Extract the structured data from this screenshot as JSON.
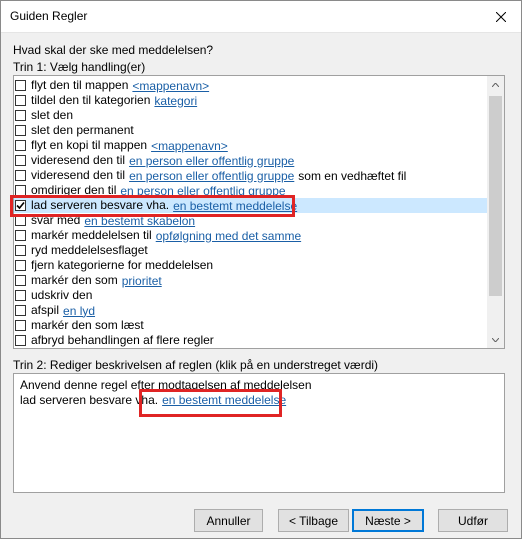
{
  "window": {
    "title": "Guiden Regler"
  },
  "prompt": "Hvad skal der ske med meddelelsen?",
  "step1_label": "Trin 1: Vælg handling(er)",
  "actions": [
    {
      "label": "flyt den til mappen",
      "link": "<mappenavn>",
      "suffix": "",
      "checked": false
    },
    {
      "label": "tildel den til kategorien",
      "link": "kategori",
      "suffix": "",
      "checked": false
    },
    {
      "label": "slet den",
      "link": "",
      "suffix": "",
      "checked": false
    },
    {
      "label": "slet den permanent",
      "link": "",
      "suffix": "",
      "checked": false
    },
    {
      "label": "flyt en kopi til mappen",
      "link": "<mappenavn>",
      "suffix": "",
      "checked": false
    },
    {
      "label": "videresend den til",
      "link": "en person eller offentlig gruppe",
      "suffix": "",
      "checked": false
    },
    {
      "label": "videresend den til",
      "link": "en person eller offentlig gruppe",
      "suffix": "som en vedhæftet fil",
      "checked": false
    },
    {
      "label": "omdiriger den til",
      "link": "en person eller offentlig gruppe",
      "suffix": "",
      "checked": false
    },
    {
      "label": "lad serveren besvare vha.",
      "link": "en bestemt meddelelse",
      "suffix": "",
      "checked": true
    },
    {
      "label": "svar med",
      "link": "en bestemt skabelon",
      "suffix": "",
      "checked": false
    },
    {
      "label": "markér meddelelsen til",
      "link": "opfølgning med det samme",
      "suffix": "",
      "checked": false
    },
    {
      "label": "ryd meddelelsesflaget",
      "link": "",
      "suffix": "",
      "checked": false
    },
    {
      "label": "fjern kategorierne for meddelelsen",
      "link": "",
      "suffix": "",
      "checked": false
    },
    {
      "label": "markér den som",
      "link": "prioritet",
      "suffix": "",
      "checked": false
    },
    {
      "label": "udskriv den",
      "link": "",
      "suffix": "",
      "checked": false
    },
    {
      "label": "afspil",
      "link": "en lyd",
      "suffix": "",
      "checked": false
    },
    {
      "label": "markér den som læst",
      "link": "",
      "suffix": "",
      "checked": false
    },
    {
      "label": "afbryd behandlingen af flere regler",
      "link": "",
      "suffix": "",
      "checked": false
    }
  ],
  "selected_index": 8,
  "step2_label": "Trin 2: Rediger beskrivelsen af reglen (klik på en understreget værdi)",
  "description": {
    "line1": "Anvend denne regel efter modtagelsen af meddelelsen",
    "line2_text": "lad serveren besvare vha.",
    "line2_link": "en bestemt meddelelse"
  },
  "buttons": {
    "cancel": "Annuller",
    "back": "< Tilbage",
    "next": "Næste >",
    "finish": "Udfør"
  },
  "colors": {
    "link": "#1a5fa6",
    "selection": "#cce8ff",
    "highlight": "#e02424",
    "default_button_border": "#0078d7"
  },
  "icons": {
    "close": "close-icon",
    "checkmark": "checkmark-icon",
    "scroll_up": "arrow-up-icon",
    "scroll_down": "arrow-down-icon"
  }
}
